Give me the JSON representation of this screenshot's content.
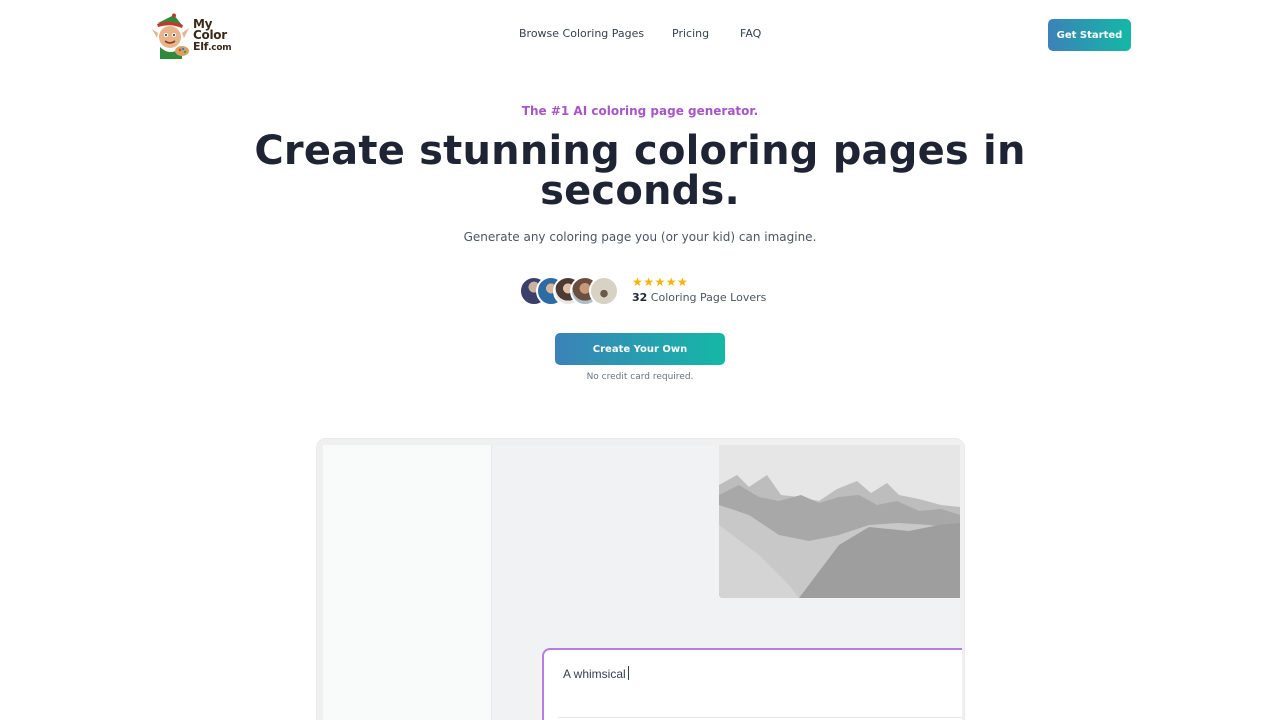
{
  "header": {
    "logo": {
      "line1": "My",
      "line2": "Color",
      "line3": "Elf",
      "line3_suffix": ".com"
    },
    "nav": [
      {
        "label": "Browse Coloring Pages"
      },
      {
        "label": "Pricing"
      },
      {
        "label": "FAQ"
      }
    ],
    "cta_label": "Get Started"
  },
  "hero": {
    "eyebrow": "The #1 AI coloring page generator.",
    "headline": "Create stunning coloring pages in seconds.",
    "subheadline": "Generate any coloring page you (or your kid) can imagine.",
    "rating": {
      "stars": "★★★★★",
      "count": "32",
      "label": " Coloring Page Lovers"
    },
    "cta_label": "Create Your Own",
    "note": "No credit card required."
  },
  "preview": {
    "prompt_text": "A whimsical"
  },
  "colors": {
    "accent_purple": "#a855c7",
    "gradient_start": "#3b82b8",
    "gradient_end": "#14b8a6",
    "star": "#f5b301"
  }
}
